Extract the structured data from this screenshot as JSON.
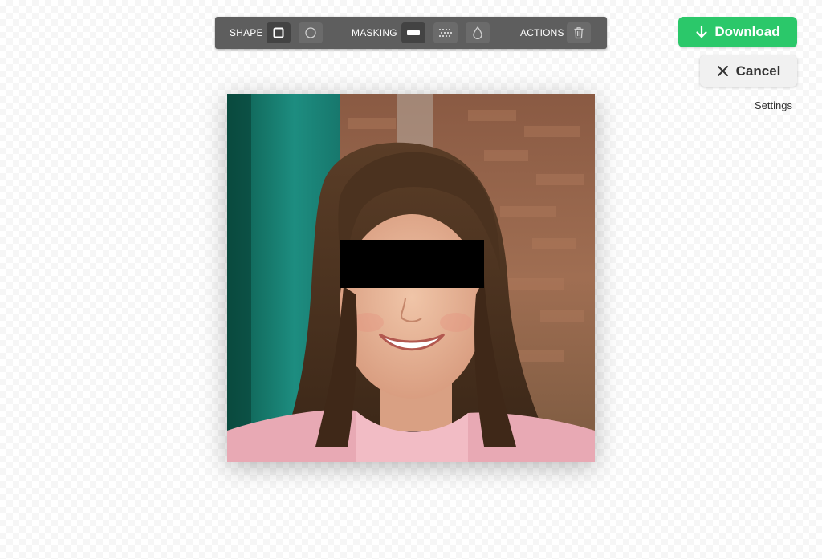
{
  "toolbar": {
    "shape_label": "SHAPE",
    "masking_label": "MASKING",
    "actions_label": "ACTIONS",
    "shape_options": [
      "square-icon",
      "circle-icon"
    ],
    "masking_options": [
      "solid-bar-icon",
      "pixelate-icon",
      "blur-drop-icon"
    ],
    "action_options": [
      "trash-icon"
    ]
  },
  "download": {
    "label": "Download",
    "icon": "arrow-down-icon",
    "color": "#2bc86a"
  },
  "cancel": {
    "label": "Cancel",
    "icon": "close-icon"
  },
  "settings": {
    "label": "Settings"
  },
  "photo": {
    "subject": "portrait-photo",
    "mask_color": "#000000"
  }
}
